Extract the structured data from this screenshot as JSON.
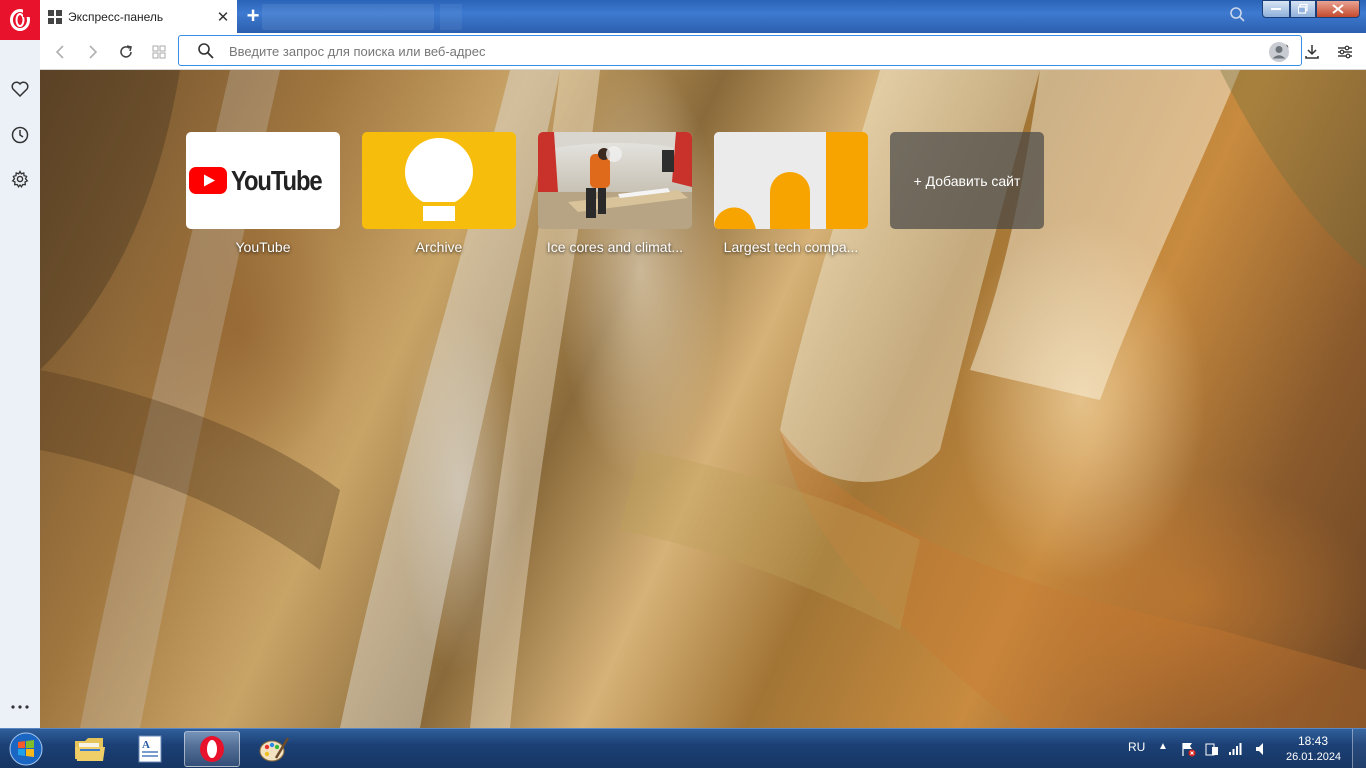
{
  "browser": {
    "tab": {
      "title": "Экспресс-панель"
    },
    "address_bar": {
      "placeholder": "Введите запрос для поиска или веб-адрес",
      "value": ""
    }
  },
  "speed_dial": [
    {
      "label": "YouTube",
      "logo_text": "YouTube"
    },
    {
      "label": "Archive"
    },
    {
      "label": "Ice cores and climat..."
    },
    {
      "label": "Largest tech compa..."
    },
    {
      "label": "+ Добавить сайт"
    }
  ],
  "taskbar": {
    "language": "RU",
    "time": "18:43",
    "date": "26.01.2024"
  },
  "colors": {
    "opera_red": "#e8122c",
    "url_focus": "#3a8ee6",
    "archive_yellow": "#f7bd0c",
    "tech_orange": "#f7a400"
  }
}
